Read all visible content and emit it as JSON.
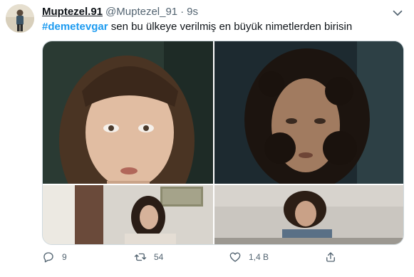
{
  "author": {
    "name": "Muptezel.91",
    "handle": "@Muptezel_91",
    "separator": "·",
    "time": "9s"
  },
  "tweet": {
    "hashtag": "#demetevgar",
    "text": " sen bu ülkeye verilmiş en büyük nimetlerden birisin"
  },
  "media": {
    "images": [
      "woman-with-bangs-closeup",
      "woman-with-curly-hair-closeup",
      "woman-seated-in-room",
      "woman-with-curly-hair-at-table"
    ]
  },
  "actions": {
    "reply_count": "9",
    "retweet_count": "54",
    "like_count": "1,4 B",
    "icons": [
      "reply-icon",
      "retweet-icon",
      "like-icon",
      "share-icon"
    ]
  },
  "colors": {
    "text": "#0f1419",
    "secondary": "#536471",
    "accent": "#1d9bf0",
    "border": "#cfd9de"
  }
}
